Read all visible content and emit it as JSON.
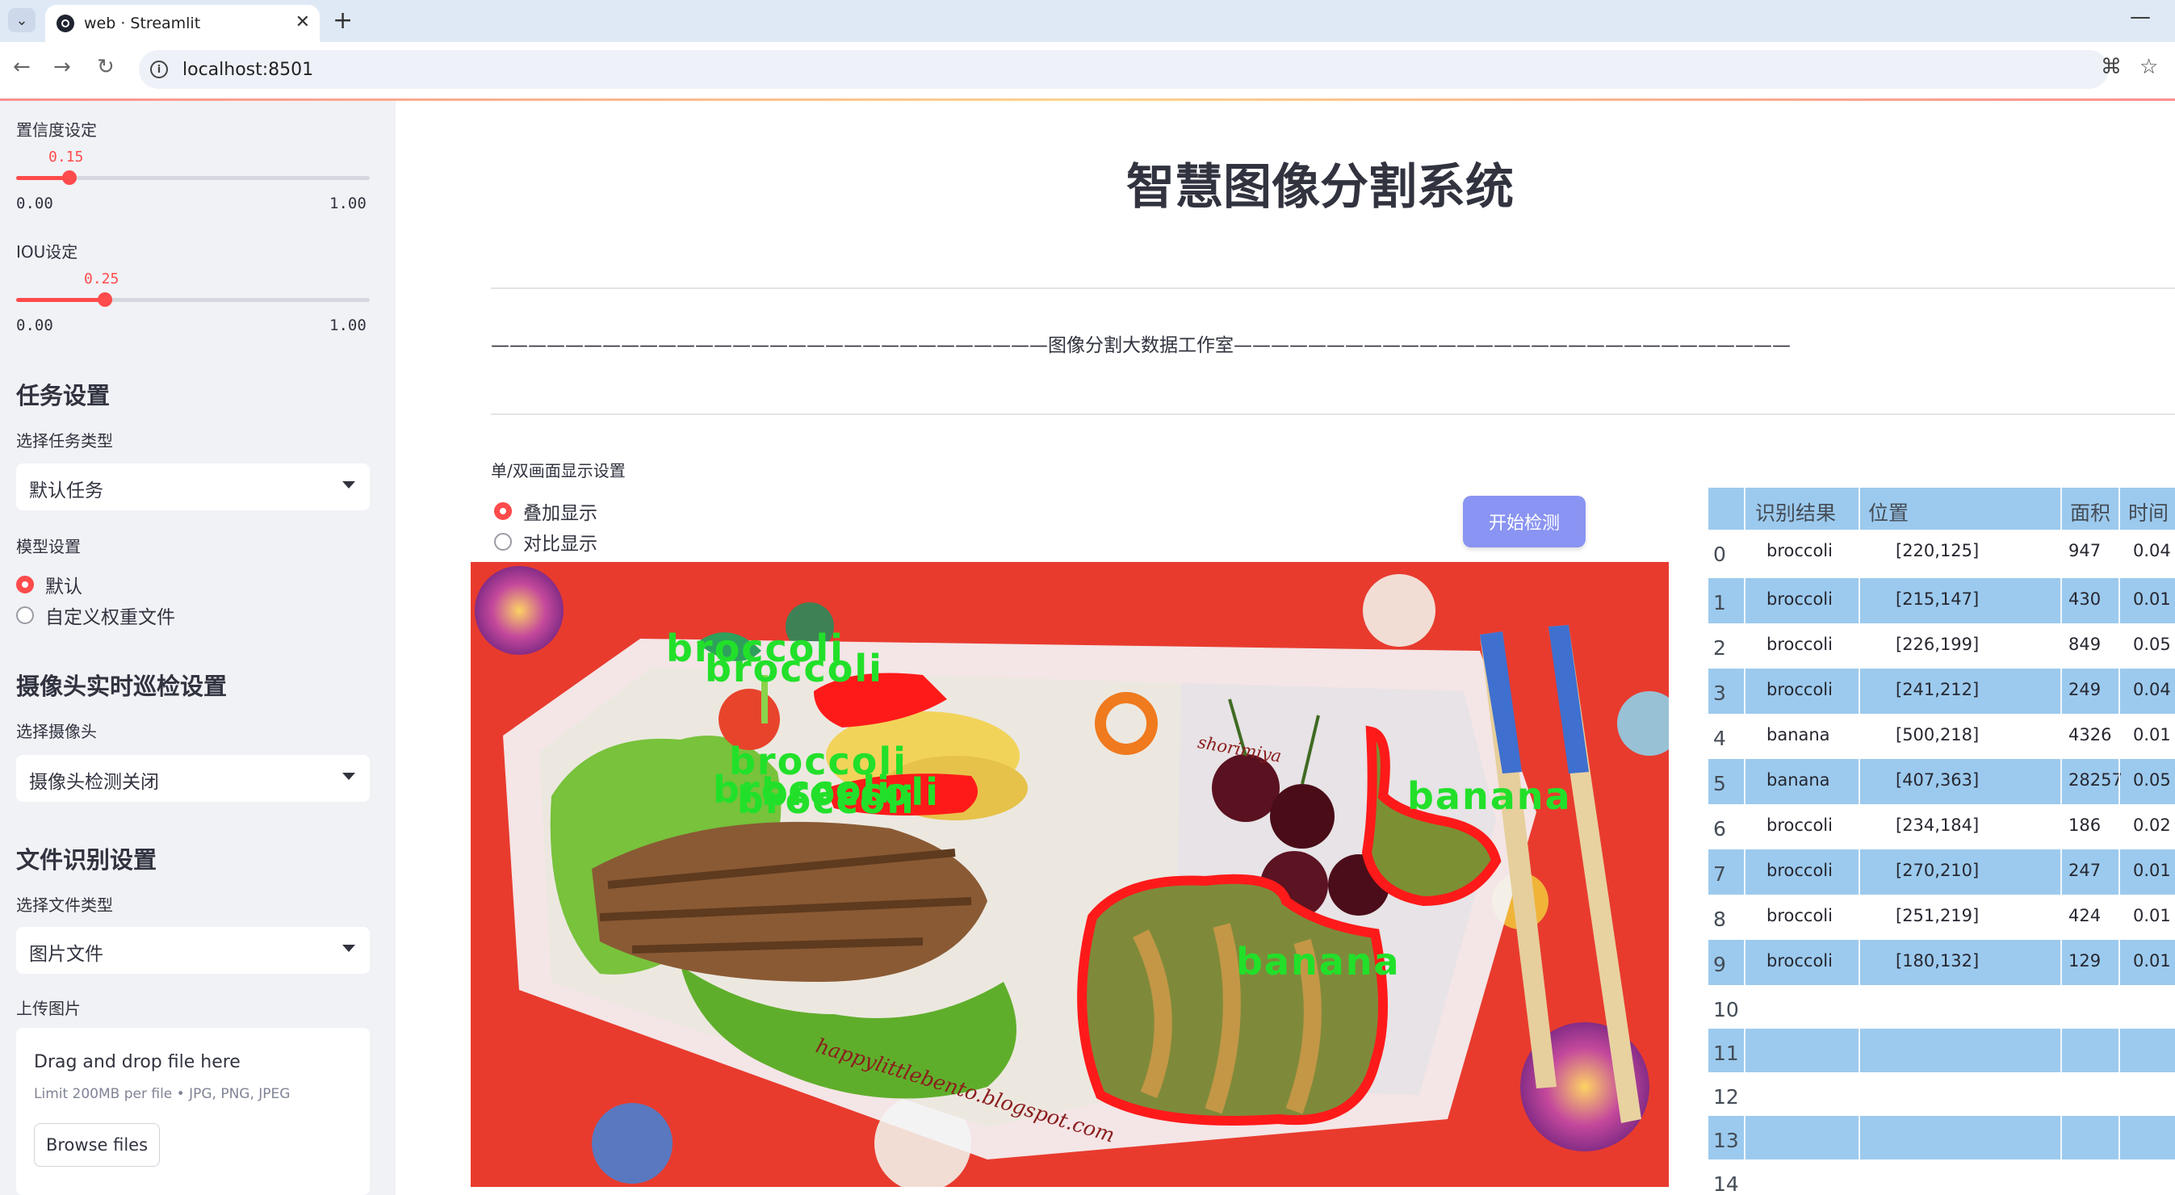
{
  "browser": {
    "tab_title": "web · Streamlit",
    "url": "localhost:8501"
  },
  "sidebar": {
    "confidence": {
      "label": "置信度设定",
      "value": "0.15",
      "min": "0.00",
      "max": "1.00",
      "fraction": 0.15
    },
    "iou": {
      "label": "IOU设定",
      "value": "0.25",
      "min": "0.00",
      "max": "1.00",
      "fraction": 0.25
    },
    "task_header": "任务设置",
    "task_type_label": "选择任务类型",
    "task_type_value": "默认任务",
    "model_label": "模型设置",
    "model_options": [
      "默认",
      "自定义权重文件"
    ],
    "model_selected": 0,
    "camera_header": "摄像头实时巡检设置",
    "camera_label": "选择摄像头",
    "camera_value": "摄像头检测关闭",
    "file_header": "文件识别设置",
    "file_type_label": "选择文件类型",
    "file_type_value": "图片文件",
    "upload_label": "上传图片",
    "upload_title": "Drag and drop file here",
    "upload_limit": "Limit 200MB per file • JPG, PNG, JPEG",
    "upload_button": "Browse files"
  },
  "main": {
    "title": "智慧图像分割系统",
    "banner": "——————————————————————————————图像分割大数据工作室——————————————————————————————",
    "display_mode_label": "单/双画面显示设置",
    "display_options": [
      "叠加显示",
      "对比显示"
    ],
    "display_selected": 0,
    "detect_button": "开始检测"
  },
  "image": {
    "labels": [
      "broccoli",
      "broccoli",
      "broccoli",
      "broccoli",
      "broccoli",
      "broccoli",
      "banana",
      "banana"
    ],
    "caption_left": "happylittlebento.blogspot.com",
    "caption_right": "shorimiya"
  },
  "table": {
    "headers": [
      "识别结果",
      "位置",
      "面积",
      "时间"
    ],
    "rows": [
      {
        "idx": "0",
        "label": "broccoli",
        "pos": "[220,125]",
        "area": "947",
        "time": "0.04"
      },
      {
        "idx": "1",
        "label": "broccoli",
        "pos": "[215,147]",
        "area": "430",
        "time": "0.01"
      },
      {
        "idx": "2",
        "label": "broccoli",
        "pos": "[226,199]",
        "area": "849",
        "time": "0.05"
      },
      {
        "idx": "3",
        "label": "broccoli",
        "pos": "[241,212]",
        "area": "249",
        "time": "0.04"
      },
      {
        "idx": "4",
        "label": "banana",
        "pos": "[500,218]",
        "area": "4326",
        "time": "0.01"
      },
      {
        "idx": "5",
        "label": "banana",
        "pos": "[407,363]",
        "area": "28257",
        "time": "0.05"
      },
      {
        "idx": "6",
        "label": "broccoli",
        "pos": "[234,184]",
        "area": "186",
        "time": "0.02"
      },
      {
        "idx": "7",
        "label": "broccoli",
        "pos": "[270,210]",
        "area": "247",
        "time": "0.01"
      },
      {
        "idx": "8",
        "label": "broccoli",
        "pos": "[251,219]",
        "area": "424",
        "time": "0.01"
      },
      {
        "idx": "9",
        "label": "broccoli",
        "pos": "[180,132]",
        "area": "129",
        "time": "0.01"
      },
      {
        "idx": "10",
        "label": "",
        "pos": "",
        "area": "",
        "time": ""
      },
      {
        "idx": "11",
        "label": "",
        "pos": "",
        "area": "",
        "time": ""
      },
      {
        "idx": "12",
        "label": "",
        "pos": "",
        "area": "",
        "time": ""
      },
      {
        "idx": "13",
        "label": "",
        "pos": "",
        "area": "",
        "time": ""
      },
      {
        "idx": "14",
        "label": "",
        "pos": "",
        "area": "",
        "time": ""
      }
    ]
  },
  "colors": {
    "accent": "#ff4b4b",
    "button": "#8a94f2",
    "table_blue": "#9ccaee",
    "overlay_text": "#22e02a",
    "mask_outline": "#ff1a1a"
  }
}
